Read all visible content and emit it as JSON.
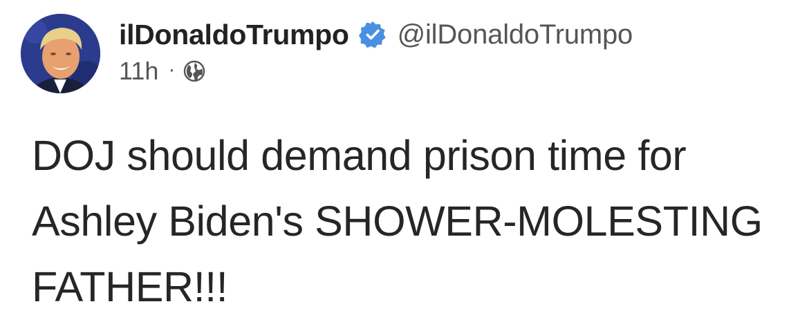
{
  "post": {
    "author": {
      "display_name": "ilDonaldoTrumpo",
      "handle": "@ilDonaldoTrumpo",
      "verified": true,
      "avatar_icon": "avatar-photo"
    },
    "meta": {
      "timestamp": "11h",
      "separator": "·",
      "visibility_icon": "globe-icon"
    },
    "text": "DOJ should demand prison time for Ashley Biden's SHOWER-MOLESTING FATHER!!!"
  },
  "colors": {
    "verified_blue": "#4a90e2",
    "text": "#262626",
    "secondary_text": "#555555"
  }
}
